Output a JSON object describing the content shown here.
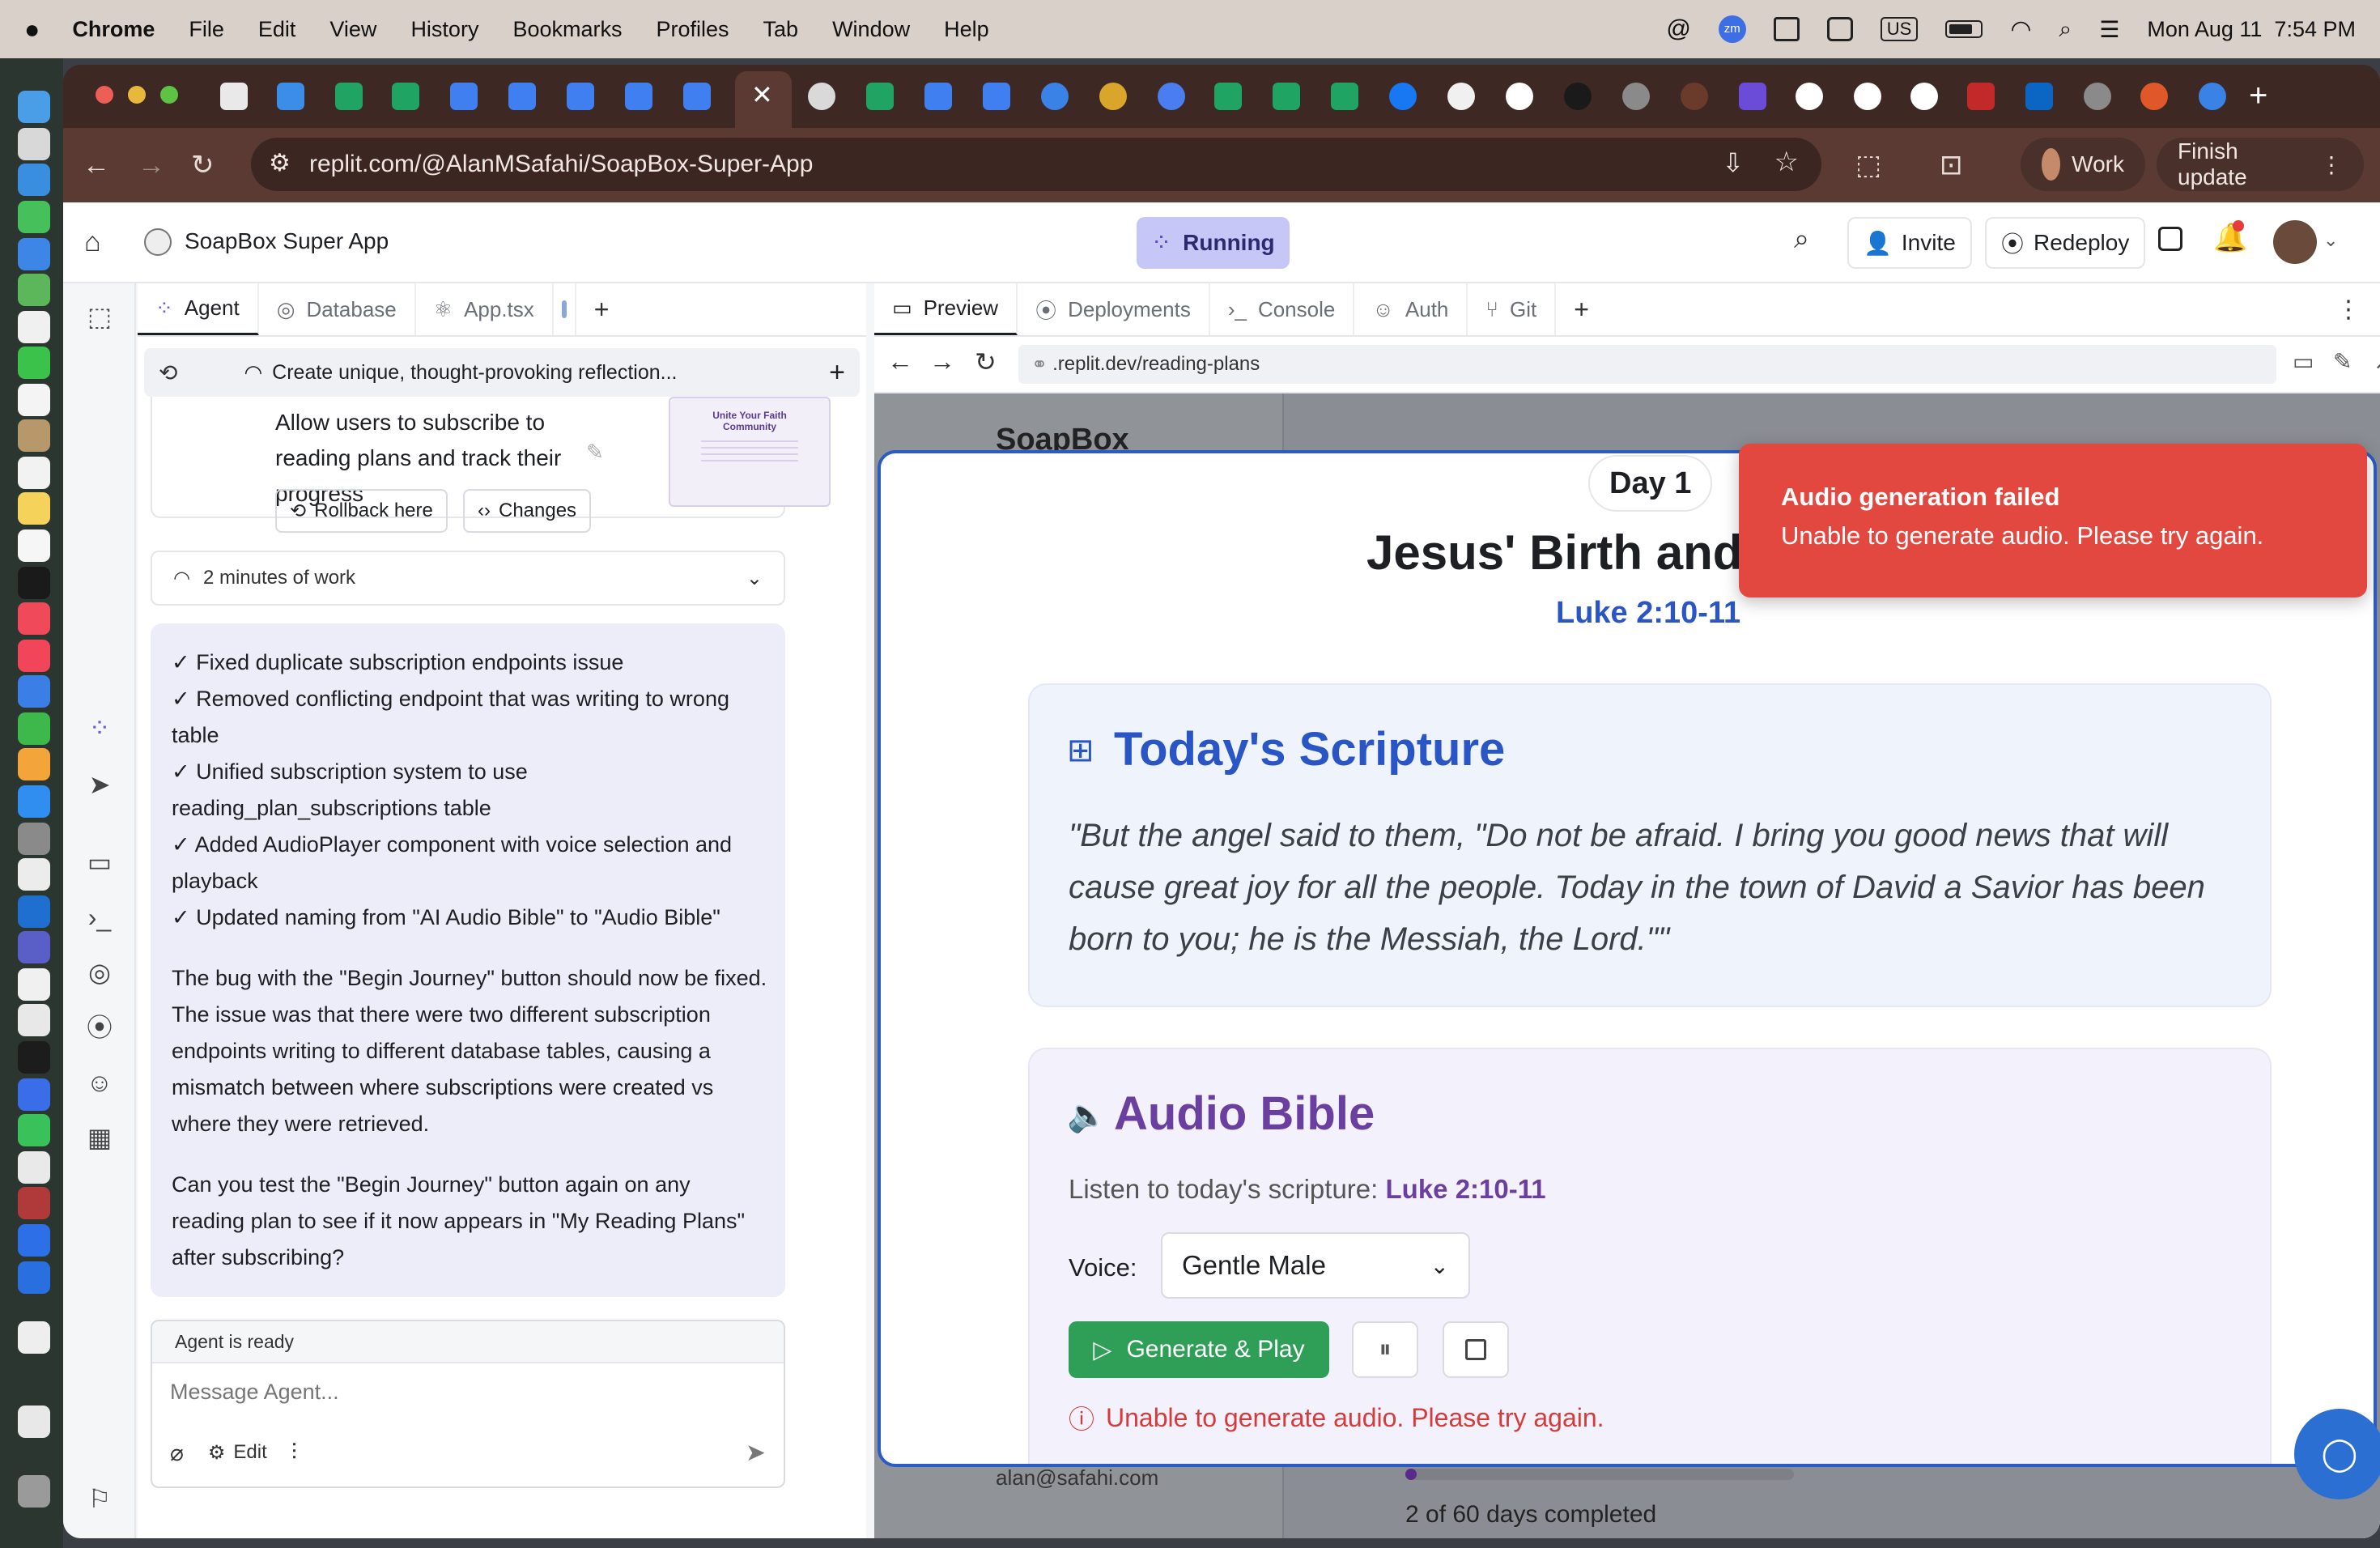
{
  "menubar": {
    "app": "Chrome",
    "items": [
      "File",
      "Edit",
      "View",
      "History",
      "Bookmarks",
      "Profiles",
      "Tab",
      "Window",
      "Help"
    ],
    "datetime": "Mon Aug 11  7:54 PM",
    "input_source": "US"
  },
  "browser": {
    "url": "replit.com/@AlanMSafahi/SoapBox-Super-App",
    "profile_label": "Work",
    "update_label": "Finish update"
  },
  "replit": {
    "project_name": "SoapBox Super App",
    "run_status": "Running",
    "invite_label": "Invite",
    "redeploy_label": "Redeploy",
    "left_tabs": [
      "Agent",
      "Database",
      "App.tsx"
    ],
    "right_tabs": [
      "Preview",
      "Deployments",
      "Console",
      "Auth",
      "Git"
    ],
    "thread_title": "Create unique, thought-provoking reflection...",
    "checkpoint": {
      "text": "Allow users to subscribe to reading plans and track their progress",
      "rollback_label": "Rollback here",
      "changes_label": "Changes",
      "thumb_title": "Unite Your Faith Community"
    },
    "work_summary": "2 minutes of work",
    "agent_message": {
      "checks": [
        "✓ Fixed duplicate subscription endpoints issue",
        "✓ Removed conflicting endpoint that was writing to wrong table",
        "✓ Unified subscription system to use reading_plan_subscriptions table",
        "✓ Added AudioPlayer component with voice selection and playback",
        "✓ Updated naming from \"AI Audio Bible\" to \"Audio Bible\""
      ],
      "paragraph1": "The bug with the \"Begin Journey\" button should now be fixed. The issue was that there were two different subscription endpoints writing to different database tables, causing a mismatch between where subscriptions were created vs where they were retrieved.",
      "paragraph2": "Can you test the \"Begin Journey\" button again on any reading plan to see if it now appears in \"My Reading Plans\" after subscribing?"
    },
    "composer": {
      "status": "Agent is ready",
      "placeholder": "Message Agent...",
      "edit_label": "Edit"
    },
    "preview_url": ".replit.dev/reading-plans"
  },
  "app_preview": {
    "brand": "SoapBox",
    "bg_email": "alan@safahi.com",
    "bg_progress": "2 of 60 days completed",
    "day_badge": "Day 1",
    "reading_title": "Jesus' Birth and",
    "reference": "Luke 2:10-11",
    "scripture_heading": "Today's Scripture",
    "scripture_text": "\"But the angel said to them, \"Do not be afraid. I bring you good news that will cause great joy for all the people. Today in the town of David a Savior has been born to you; he is the Messiah, the Lord.\"\"",
    "audio_heading": "Audio Bible",
    "listen_prefix": "Listen to today's scripture:",
    "listen_ref": "Luke 2:10-11",
    "voice_label": "Voice:",
    "voice_value": "Gentle Male",
    "generate_label": "Generate & Play",
    "error_text": "Unable to generate audio. Please try again.",
    "toast_title": "Audio generation failed",
    "toast_body": "Unable to generate audio. Please try again."
  },
  "colors": {
    "accent_purple": "#6b3fa0",
    "scripture_blue": "#2a55c5",
    "play_green": "#2f9e57",
    "error_red": "#d63b3b",
    "toast_bg": "#e2483f",
    "agent_bubble": "#ecedf8"
  }
}
